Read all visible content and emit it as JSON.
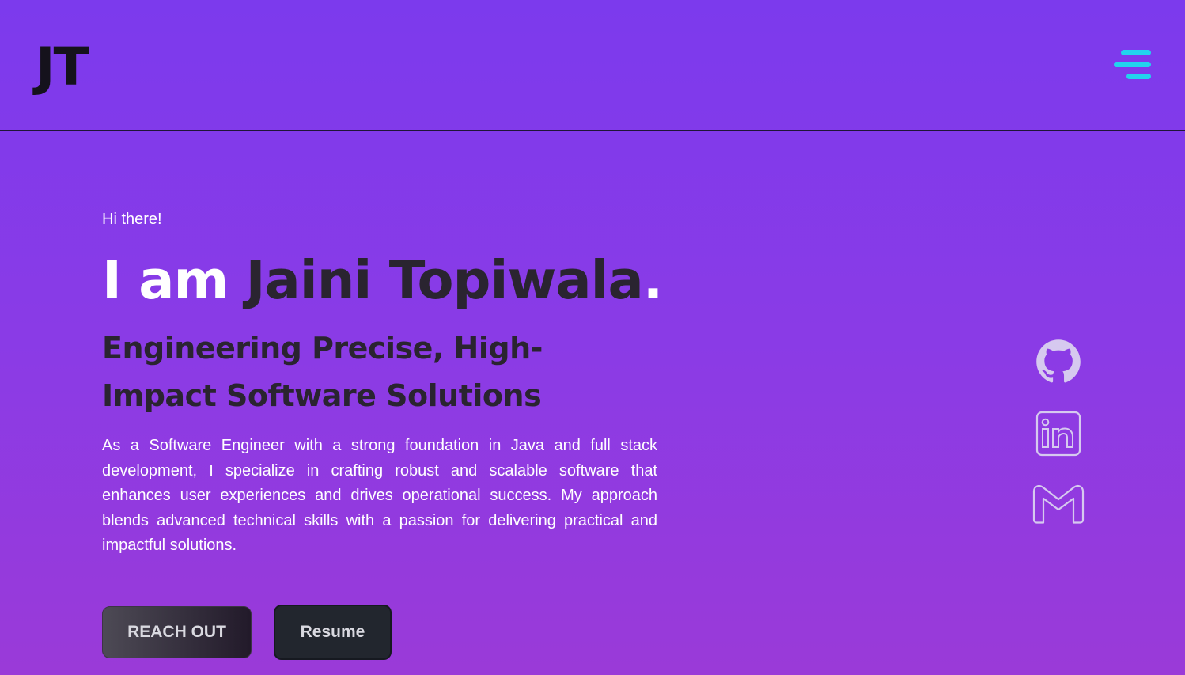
{
  "header": {
    "logo": "JT",
    "menu_icon": "hamburger-menu-icon",
    "menu_color": "#22d3ee"
  },
  "hero": {
    "greeting": "Hi there!",
    "intro": "I am ",
    "name": "Jaini Topiwala",
    "name_suffix": ".",
    "tagline": "Engineering Precise, High-Impact Software Solutions",
    "description": "As a Software Engineer with a strong foundation in Java and full stack development, I specialize in crafting robust and scalable software that enhances user experiences and drives operational success. My approach blends advanced technical skills with a passion for delivering practical and impactful solutions.",
    "buttons": {
      "reach_out": "REACH OUT",
      "resume": "Resume"
    }
  },
  "social": {
    "items": [
      {
        "name": "github",
        "icon": "github-icon"
      },
      {
        "name": "linkedin",
        "icon": "linkedin-icon"
      },
      {
        "name": "gmail",
        "icon": "gmail-icon"
      }
    ]
  },
  "colors": {
    "background_top": "#7c3aed",
    "background_bottom": "#9a3ad8",
    "dark_text": "#2a2430",
    "accent": "#22d3ee",
    "icon_stroke": "#d6c9ef"
  }
}
